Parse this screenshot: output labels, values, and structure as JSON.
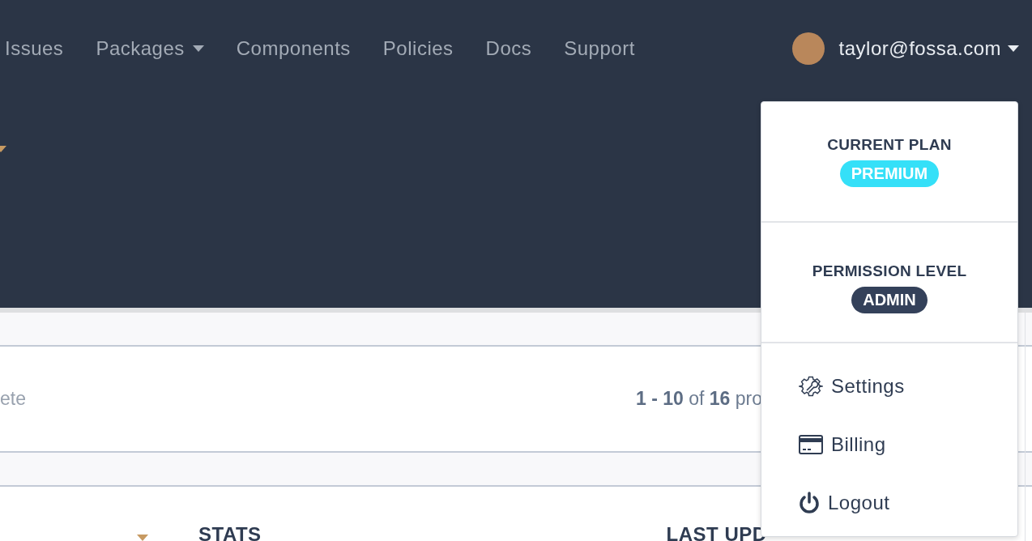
{
  "nav": {
    "items": [
      {
        "label": "Issues",
        "has_menu": false
      },
      {
        "label": "Packages",
        "has_menu": true
      },
      {
        "label": "Components",
        "has_menu": false
      },
      {
        "label": "Policies",
        "has_menu": false
      },
      {
        "label": "Docs",
        "has_menu": false
      },
      {
        "label": "Support",
        "has_menu": false
      }
    ],
    "user": {
      "email": "taylor@fossa.com",
      "menu_open": true
    }
  },
  "toolbar": {
    "filter_text": "ete",
    "pagination": "**1 - 10** of **16** pro"
  },
  "table": {
    "columns": [
      {
        "label": "STATS"
      },
      {
        "label": "LAST UPD"
      }
    ]
  },
  "user_menu": {
    "sections": [
      {
        "title": "CURRENT PLAN",
        "badge": "PREMIUM",
        "kind": "plan"
      },
      {
        "title": "PERMISSION LEVEL",
        "badge": "ADMIN",
        "kind": "role"
      }
    ],
    "items": [
      {
        "label": "Settings",
        "kind": "settings"
      },
      {
        "label": "Billing",
        "kind": "billing"
      },
      {
        "label": "Logout",
        "kind": "logout"
      }
    ]
  }
}
